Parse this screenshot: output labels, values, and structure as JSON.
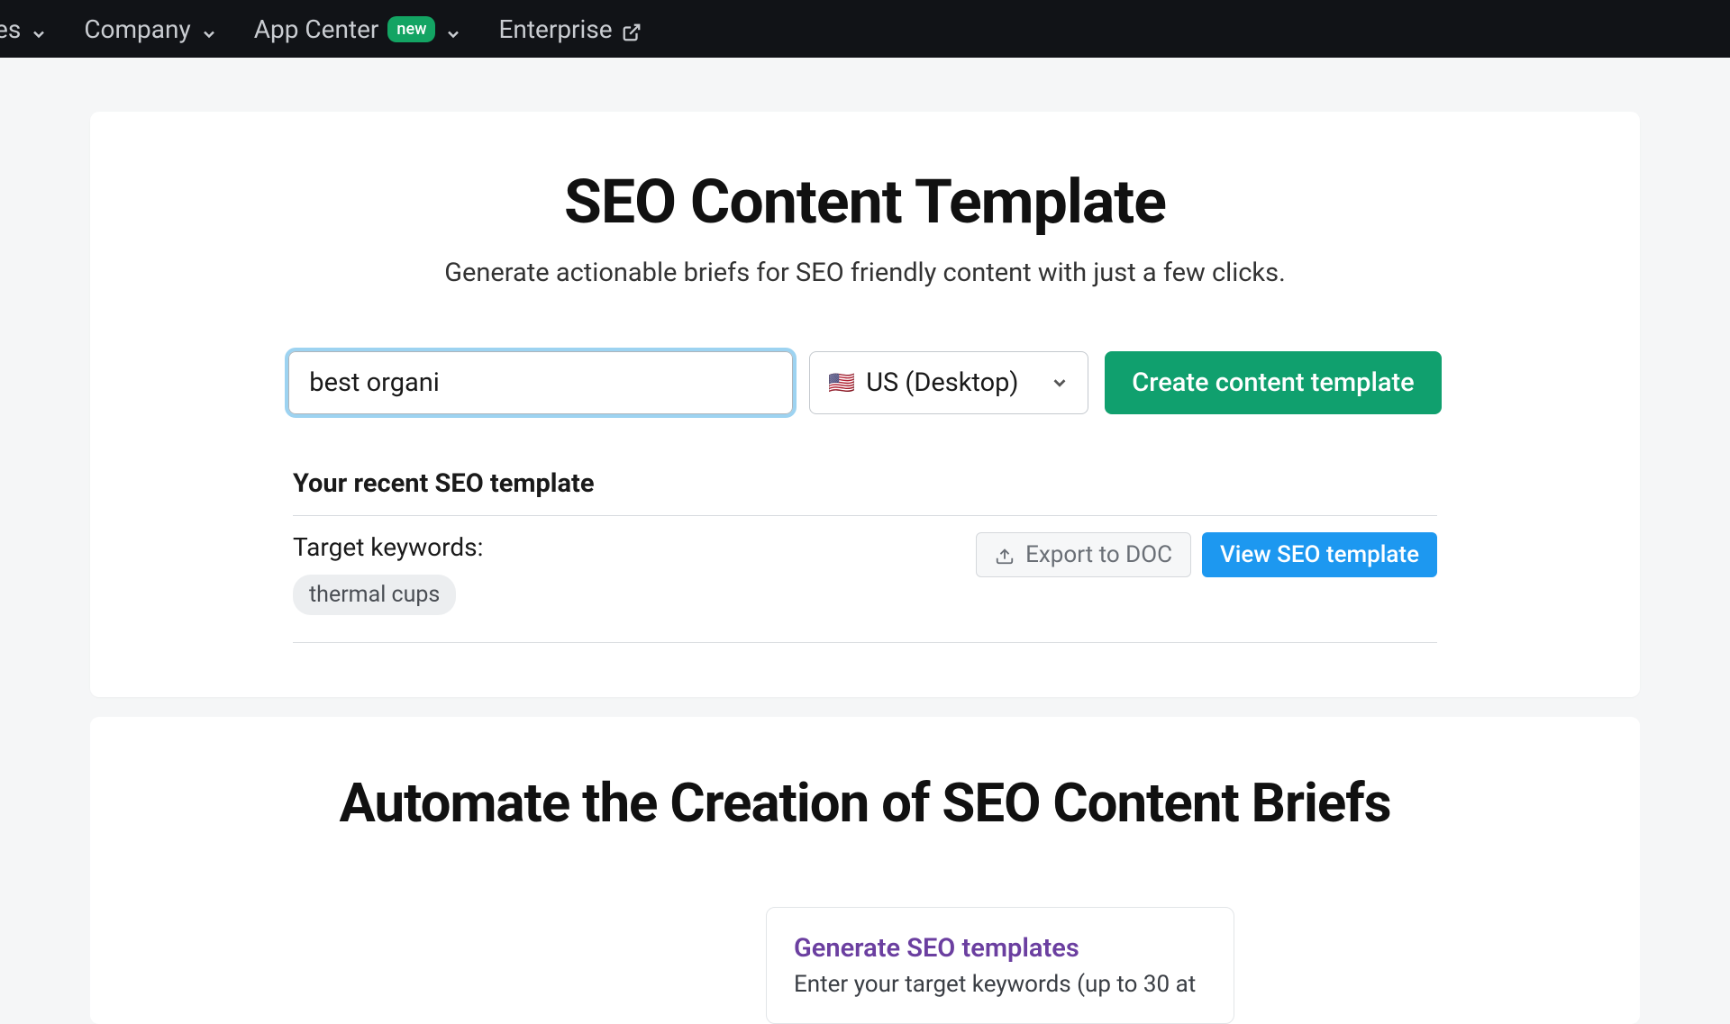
{
  "nav": {
    "item_partial": "es",
    "company": "Company",
    "app_center": "App Center",
    "new_badge": "new",
    "enterprise": "Enterprise"
  },
  "main": {
    "title": "SEO Content Template",
    "subtitle": "Generate actionable briefs for SEO friendly content with just a few clicks.",
    "keyword_value": "best organi",
    "locale_flag": "🇺🇸",
    "locale_label": "US (Desktop)",
    "create_btn": "Create content template"
  },
  "recent": {
    "heading": "Your recent SEO template",
    "target_label": "Target keywords:",
    "keyword_chip": "thermal cups",
    "export_label": "Export to DOC",
    "view_label": "View SEO template"
  },
  "section2": {
    "title": "Automate the Creation of SEO Content Briefs",
    "subcard_title": "Generate SEO templates",
    "subcard_body": "Enter your target keywords (up to 30 at"
  }
}
